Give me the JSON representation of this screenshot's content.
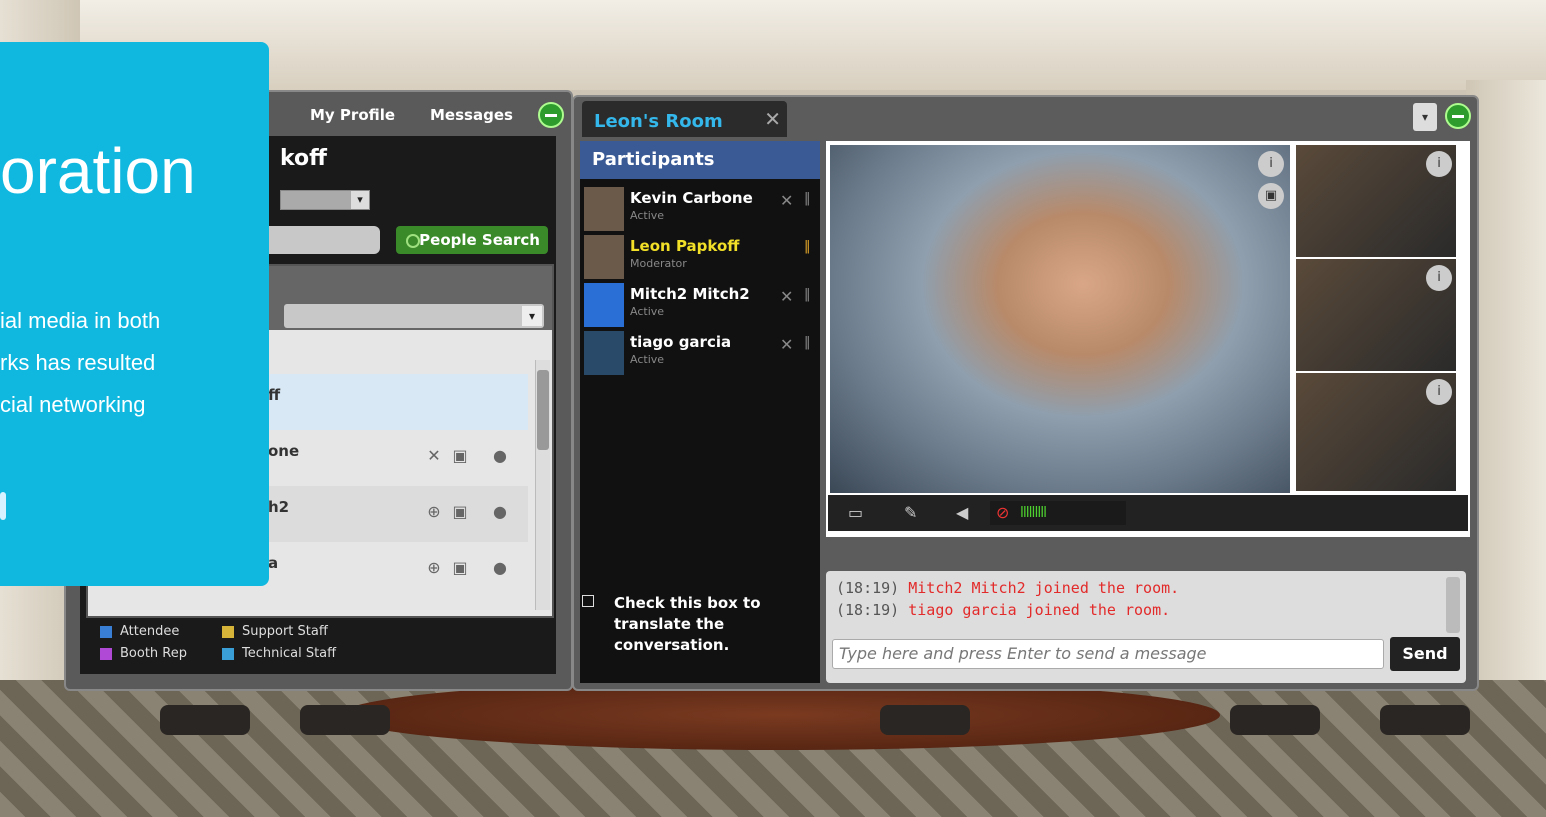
{
  "overlay": {
    "title_fragment": "oration",
    "body_lines": [
      "ial media in both",
      "rks has resulted",
      "cial networking"
    ]
  },
  "left_panel": {
    "tabs": [
      "My Profile",
      "Messages"
    ],
    "user_name_fragment": "koff",
    "people_search_label": "People Search",
    "users_list": [
      {
        "name": "ff"
      },
      {
        "name": "one"
      },
      {
        "name": "h2"
      },
      {
        "name": "a"
      }
    ],
    "legend": {
      "attendee": "Attendee",
      "booth_rep": "Booth Rep",
      "support_staff": "Support Staff",
      "technical_staff": "Technical Staff"
    }
  },
  "room": {
    "title": "Leon's Room",
    "participants_header": "Participants",
    "participants": [
      {
        "name": "Kevin Carbone",
        "status": "Active",
        "color": "#ffffff"
      },
      {
        "name": "Leon Papkoff",
        "status": "Moderator",
        "color": "#f2e028"
      },
      {
        "name": "Mitch2 Mitch2",
        "status": "Active",
        "color": "#ffffff"
      },
      {
        "name": "tiago garcia",
        "status": "Active",
        "color": "#ffffff"
      }
    ],
    "translate_text": "Check this box to translate the conversation.",
    "chat_messages": [
      {
        "time": "(18:19)",
        "text": "Mitch2 Mitch2 joined the room."
      },
      {
        "time": "(18:19)",
        "text": "tiago garcia joined the room."
      }
    ],
    "chat_placeholder": "Type here and press Enter to send a message",
    "send_label": "Send",
    "volume_bars": "lllllllll"
  },
  "colors": {
    "accent_blue": "#10b8e0",
    "title_blue": "#34b7ea",
    "people_search_green": "#3a8a2a",
    "chat_red": "#e32a2a"
  }
}
